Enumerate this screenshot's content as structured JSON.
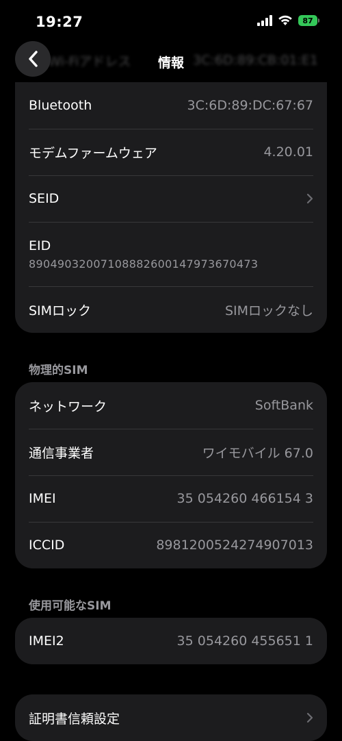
{
  "status": {
    "time": "19:27",
    "battery": "87"
  },
  "nav": {
    "title": "情報",
    "ghost_label": "Wi-Fiアドレス",
    "ghost_value": "3C:6D:89:CB:01:E1"
  },
  "info_rows": [
    {
      "label": "Bluetooth",
      "value": "3C:6D:89:DC:67:67"
    },
    {
      "label": "モデムファームウェア",
      "value": "4.20.01"
    },
    {
      "label": "SEID",
      "chevron": true
    },
    {
      "label": "EID",
      "value": "89049032007108882600147973670473"
    },
    {
      "label": "SIMロック",
      "value": "SIMロックなし"
    }
  ],
  "physical_sim": {
    "header": "物理的SIM",
    "rows": [
      {
        "label": "ネットワーク",
        "value": "SoftBank"
      },
      {
        "label": "通信事業者",
        "value": "ワイモバイル 67.0"
      },
      {
        "label": "IMEI",
        "value": "35 054260 466154 3"
      },
      {
        "label": "ICCID",
        "value": "8981200524274907013"
      }
    ]
  },
  "available_sim": {
    "header": "使用可能なSIM",
    "rows": [
      {
        "label": "IMEI2",
        "value": "35 054260 455651 1"
      }
    ]
  },
  "certificate": {
    "label": "証明書信頼設定"
  },
  "colors": {
    "background": "#000000",
    "card": "#1c1c1e",
    "secondary_text": "#98989d",
    "battery_green": "#34c759"
  }
}
